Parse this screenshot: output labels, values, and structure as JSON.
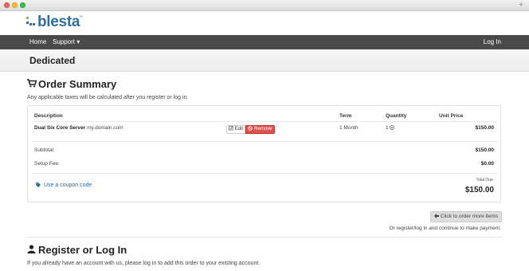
{
  "window": {
    "new_tab_symbol": "+"
  },
  "brand": {
    "name": "blesta",
    "trademark": "™"
  },
  "nav": {
    "home": "Home",
    "support": "Support ▾",
    "login": "Log In"
  },
  "page": {
    "title": "Dedicated"
  },
  "order_summary": {
    "heading": "Order Summary",
    "tax_note": "Any applicable taxes will be calculated after you register or log in.",
    "columns": {
      "description": "Description",
      "term": "Term",
      "quantity": "Quantity",
      "unit_price": "Unit Price"
    },
    "item": {
      "name": "Dual Six Core Server",
      "domain": "my.domain.com",
      "term": "1 Month",
      "quantity": "1",
      "unit_price": "$150.00",
      "edit_label": "Edit",
      "remove_label": "Remove"
    },
    "subtotal_label": "Subtotal:",
    "subtotal_value": "$150.00",
    "setup_fee_label": "Setup Fee:",
    "setup_fee_value": "$0.00",
    "coupon_link": "Use a coupon code",
    "total_due_label": "Total Due:",
    "total_due_value": "$150.00",
    "order_more_button": "Click to order more items",
    "continue_note": "Or register/log in and continue to make payment."
  },
  "register": {
    "heading": "Register or Log In",
    "intro": "If you already have an account with us, please log in to add this order to your existing account."
  },
  "colors": {
    "nav_bg": "#4a4a4a",
    "link": "#2a6a9a",
    "danger": "#d9534f",
    "brand": "#2f6f9f"
  }
}
